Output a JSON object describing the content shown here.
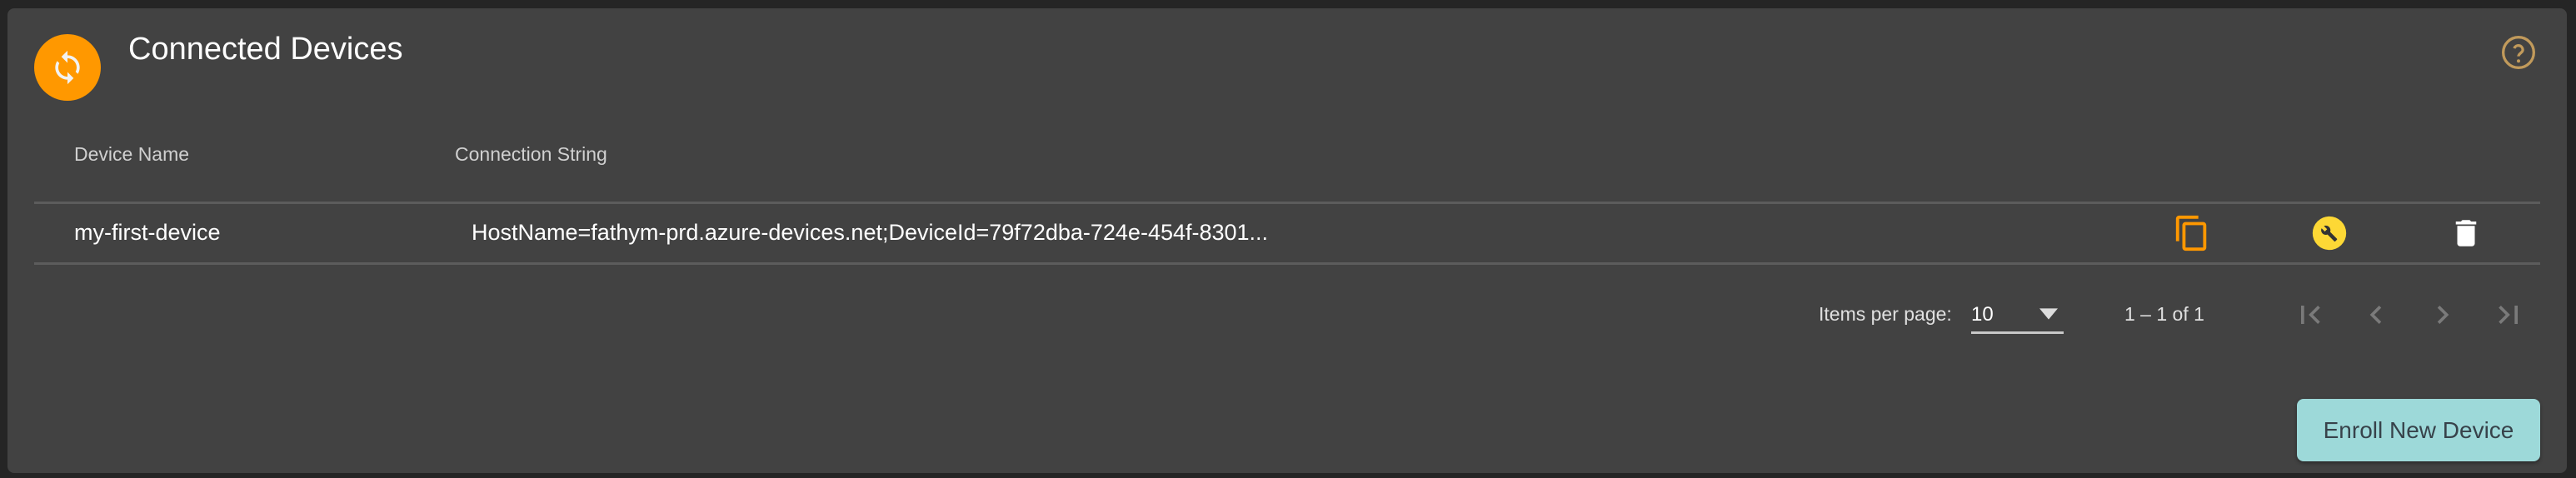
{
  "header": {
    "title": "Connected Devices",
    "avatar_icon": "sync-icon",
    "help_icon": "help-circle-icon"
  },
  "table": {
    "columns": [
      "Device Name",
      "Connection String"
    ],
    "rows": [
      {
        "device_name": "my-first-device",
        "connection_string": "HostName=fathym-prd.azure-devices.net;DeviceId=79f72dba-724e-454f-8301...",
        "actions": [
          "copy-icon",
          "wrench-icon",
          "trash-icon"
        ]
      }
    ]
  },
  "paginator": {
    "items_per_page_label": "Items per page:",
    "items_per_page_value": "10",
    "range_label": "1 – 1 of 1"
  },
  "actions": {
    "enroll_label": "Enroll New Device"
  },
  "colors": {
    "accent": "#ff9800",
    "wrench": "#fdd835",
    "button": "#9dd9d9",
    "help": "#c19a5b",
    "card": "#424242"
  }
}
